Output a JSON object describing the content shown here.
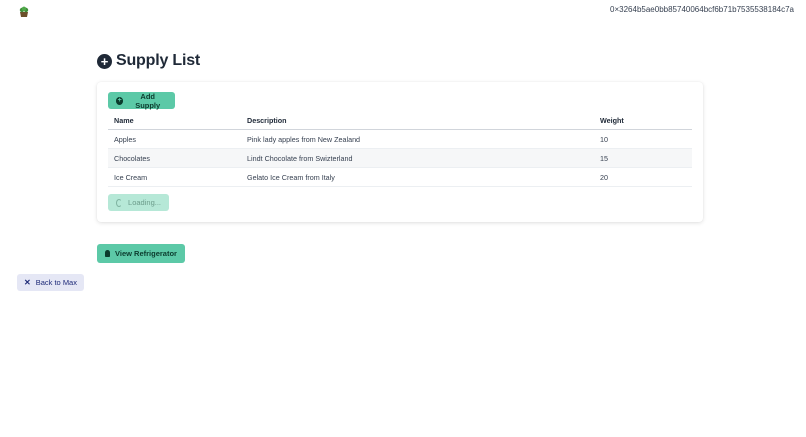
{
  "header": {
    "logo_icon": "plant-icon",
    "account_address": "0×3264b5ae0bb85740064bcf6b71b7535538184c7a"
  },
  "page": {
    "title": "Supply List",
    "title_icon": "plus-circle-icon"
  },
  "supply_card": {
    "add_button_label": "Add Supply",
    "add_button_icon": "plus-circle-icon",
    "table": {
      "headers": [
        "Name",
        "Description",
        "Weight"
      ],
      "rows": [
        [
          "Apples",
          "Pink lady apples from New Zealand",
          "10"
        ],
        [
          "Chocolates",
          "Lindt Chocolate from Swizterland",
          "15"
        ],
        [
          "Ice Cream",
          "Gelato Ice Cream from Italy",
          "20"
        ]
      ]
    },
    "loading_button_label": "Loading...",
    "loading_icon": "spinner-icon"
  },
  "actions": {
    "view_refrigerator_label": "View Refrigerator",
    "view_refrigerator_icon": "lightbulb-icon",
    "back_label": "Back to Max",
    "back_icon": "close-icon"
  },
  "colors": {
    "accent": "#5cc9a7",
    "accent_disabled": "#b6e8d7",
    "back_button_bg": "#e5e7f5",
    "back_button_text": "#1e2a78"
  }
}
